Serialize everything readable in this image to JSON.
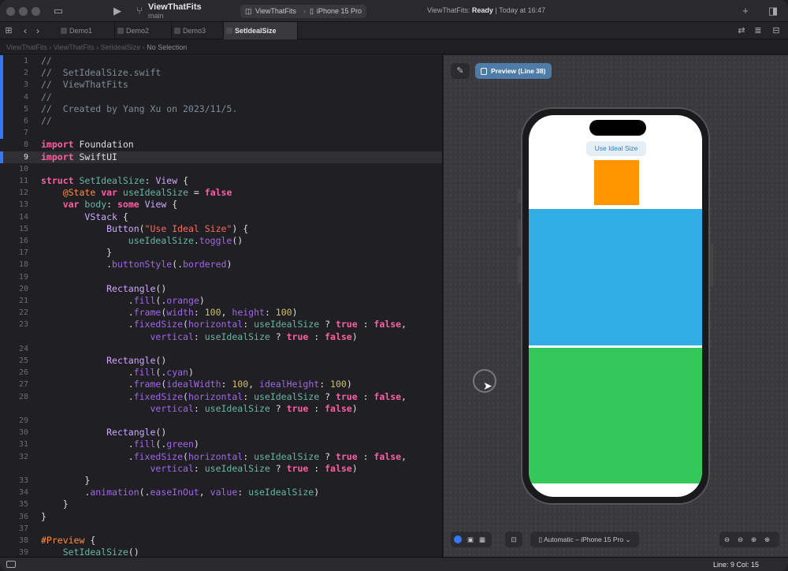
{
  "window": {
    "project_name": "ViewThatFits",
    "branch": "main",
    "scheme_target": "ViewThatFits",
    "scheme_device": "iPhone 15 Pro",
    "status_prefix": "ViewThatFits: ",
    "status_state": "Ready",
    "status_time": "| Today at 16:47"
  },
  "tabs": [
    {
      "label": "Demo1",
      "active": false
    },
    {
      "label": "Demo2",
      "active": false
    },
    {
      "label": "Demo3",
      "active": false
    },
    {
      "label": "SetIdealSize",
      "active": true
    }
  ],
  "breadcrumb": {
    "path": "ViewThatFits  ›  ViewThatFits  ›  SetIdealSize  ›",
    "selection": "No Selection"
  },
  "editor": {
    "current_line": 9,
    "lines": [
      {
        "n": "1",
        "html": "<span class='cm'>//</span>"
      },
      {
        "n": "2",
        "html": "<span class='cm'>//  SetIdealSize.swift</span>"
      },
      {
        "n": "3",
        "html": "<span class='cm'>//  ViewThatFits</span>"
      },
      {
        "n": "4",
        "html": "<span class='cm'>//</span>"
      },
      {
        "n": "5",
        "html": "<span class='cm'>//  Created by Yang Xu on 2023/11/5.</span>"
      },
      {
        "n": "6",
        "html": "<span class='cm'>//</span>"
      },
      {
        "n": "7",
        "html": ""
      },
      {
        "n": "8",
        "html": "<span class='kw'>import</span> Foundation"
      },
      {
        "n": "9",
        "html": "<span class='kw'>import</span> SwiftUI"
      },
      {
        "n": "10",
        "html": ""
      },
      {
        "n": "11",
        "html": "<span class='kw'>struct</span> <span class='prop'>SetIdealSize</span>: <span class='ty'>View</span> {"
      },
      {
        "n": "12",
        "html": "    <span class='pp'>@State</span> <span class='kw'>var</span> <span class='prop'>useIdealSize</span> = <span class='kw'>false</span>"
      },
      {
        "n": "13",
        "html": "    <span class='kw'>var</span> <span class='prop'>body</span>: <span class='kw'>some</span> <span class='ty'>View</span> {"
      },
      {
        "n": "14",
        "html": "        <span class='ty'>VStack</span> {"
      },
      {
        "n": "15",
        "html": "            <span class='ty'>Button</span>(<span class='str'>\"Use Ideal Size\"</span>) {"
      },
      {
        "n": "16",
        "html": "                <span class='prop'>useIdealSize</span>.<span class='fn'>toggle</span>()"
      },
      {
        "n": "17",
        "html": "            }"
      },
      {
        "n": "18",
        "html": "            .<span class='fn'>buttonStyle</span>(.<span class='fn'>bordered</span>)"
      },
      {
        "n": "19",
        "html": ""
      },
      {
        "n": "20",
        "html": "            <span class='ty'>Rectangle</span>()"
      },
      {
        "n": "21",
        "html": "                .<span class='fn'>fill</span>(.<span class='fn'>orange</span>)"
      },
      {
        "n": "22",
        "html": "                .<span class='fn'>frame</span>(<span class='fn'>width</span>: <span class='num'>100</span>, <span class='fn'>height</span>: <span class='num'>100</span>)"
      },
      {
        "n": "23",
        "html": "                .<span class='fn'>fixedSize</span>(<span class='fn'>horizontal</span>: <span class='prop'>useIdealSize</span> ? <span class='kw'>true</span> : <span class='kw'>false</span>,"
      },
      {
        "n": "",
        "html": "                    <span class='fn'>vertical</span>: <span class='prop'>useIdealSize</span> ? <span class='kw'>true</span> : <span class='kw'>false</span>)"
      },
      {
        "n": "24",
        "html": ""
      },
      {
        "n": "25",
        "html": "            <span class='ty'>Rectangle</span>()"
      },
      {
        "n": "26",
        "html": "                .<span class='fn'>fill</span>(.<span class='fn'>cyan</span>)"
      },
      {
        "n": "27",
        "html": "                .<span class='fn'>frame</span>(<span class='fn'>idealWidth</span>: <span class='num'>100</span>, <span class='fn'>idealHeight</span>: <span class='num'>100</span>)"
      },
      {
        "n": "28",
        "html": "                .<span class='fn'>fixedSize</span>(<span class='fn'>horizontal</span>: <span class='prop'>useIdealSize</span> ? <span class='kw'>true</span> : <span class='kw'>false</span>,"
      },
      {
        "n": "",
        "html": "                    <span class='fn'>vertical</span>: <span class='prop'>useIdealSize</span> ? <span class='kw'>true</span> : <span class='kw'>false</span>)"
      },
      {
        "n": "29",
        "html": ""
      },
      {
        "n": "30",
        "html": "            <span class='ty'>Rectangle</span>()"
      },
      {
        "n": "31",
        "html": "                .<span class='fn'>fill</span>(.<span class='fn'>green</span>)"
      },
      {
        "n": "32",
        "html": "                .<span class='fn'>fixedSize</span>(<span class='fn'>horizontal</span>: <span class='prop'>useIdealSize</span> ? <span class='kw'>true</span> : <span class='kw'>false</span>,"
      },
      {
        "n": "",
        "html": "                    <span class='fn'>vertical</span>: <span class='prop'>useIdealSize</span> ? <span class='kw'>true</span> : <span class='kw'>false</span>)"
      },
      {
        "n": "33",
        "html": "        }"
      },
      {
        "n": "34",
        "html": "        .<span class='fn'>animation</span>(.<span class='fn'>easeInOut</span>, <span class='fn'>value</span>: <span class='prop'>useIdealSize</span>)"
      },
      {
        "n": "35",
        "html": "    }"
      },
      {
        "n": "36",
        "html": "}"
      },
      {
        "n": "37",
        "html": ""
      },
      {
        "n": "38",
        "html": "<span class='pp'>#Preview</span> {"
      },
      {
        "n": "39",
        "html": "    <span class='prop'>SetIdealSize</span>()"
      }
    ]
  },
  "canvas": {
    "preview_label": "Preview (Line 38)",
    "button_label": "Use Ideal Size",
    "device_selector": "Automatic – iPhone 15 Pro",
    "colors": {
      "orange": "#ff9500",
      "cyan": "#32ade6",
      "green": "#34c759"
    }
  },
  "statusbar": {
    "line_col": "Line: 9  Col: 15"
  }
}
